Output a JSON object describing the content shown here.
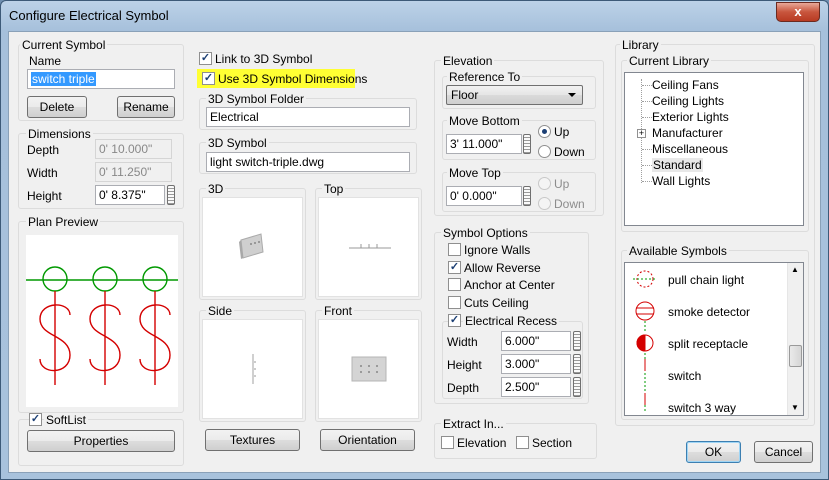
{
  "window": {
    "title": "Configure Electrical Symbol",
    "close_glyph": "x"
  },
  "current_symbol": {
    "group_label": "Current Symbol",
    "name_label": "Name",
    "name_value": "switch triple",
    "delete_label": "Delete",
    "rename_label": "Rename"
  },
  "dimensions": {
    "group_label": "Dimensions",
    "depth_label": "Depth",
    "depth_value": "0' 10.000\"",
    "width_label": "Width",
    "width_value": "0' 11.250\"",
    "height_label": "Height",
    "height_value": "0' 8.375\""
  },
  "plan_preview": {
    "group_label": "Plan Preview"
  },
  "softlist": {
    "label": "SoftList",
    "checked": true,
    "properties_label": "Properties"
  },
  "symbol3d": {
    "link_label": "Link to 3D Symbol",
    "link_checked": true,
    "use_dims_label": "Use 3D Symbol Dimensions",
    "use_dims_checked": true,
    "folder_label": "3D Symbol Folder",
    "folder_value": "Electrical",
    "symbol_label": "3D Symbol",
    "symbol_value": "light switch-triple.dwg",
    "highlight_color": "#ffff33"
  },
  "views": {
    "v3d": "3D",
    "top": "Top",
    "side": "Side",
    "front": "Front"
  },
  "textures_label": "Textures",
  "orientation_label": "Orientation",
  "elevation": {
    "group_label": "Elevation",
    "reference_label": "Reference To",
    "reference_value": "Floor",
    "move_bottom_label": "Move Bottom",
    "move_bottom_value": "3' 11.000\"",
    "move_top_label": "Move Top",
    "move_top_value": "0' 0.000\"",
    "up_label": "Up",
    "down_label": "Down"
  },
  "symbol_options": {
    "group_label": "Symbol Options",
    "ignore_walls": "Ignore Walls",
    "allow_reverse": "Allow Reverse",
    "anchor_center": "Anchor at Center",
    "cuts_ceiling": "Cuts Ceiling",
    "electrical_recess": "Electrical Recess",
    "width_label": "Width",
    "width_value": "6.000\"",
    "height_label": "Height",
    "height_value": "3.000\"",
    "depth_label": "Depth",
    "depth_value": "2.500\""
  },
  "extract": {
    "group_label": "Extract In...",
    "elevation": "Elevation",
    "section": "Section"
  },
  "library": {
    "group_label": "Library",
    "current_label": "Current Library",
    "items": [
      "Ceiling Fans",
      "Ceiling Lights",
      "Exterior Lights",
      "Manufacturer",
      "Miscellaneous",
      "Standard",
      "Wall Lights"
    ],
    "expand_glyph": "+",
    "available_label": "Available Symbols",
    "symbols": [
      "pull chain light",
      "smoke detector",
      "split receptacle",
      "switch",
      "switch 3 way"
    ],
    "scroll_up": "▲",
    "scroll_down": "▼"
  },
  "ok_label": "OK",
  "cancel_label": "Cancel",
  "colors": {
    "plan_red": "#d40000",
    "plan_green": "#009900"
  }
}
